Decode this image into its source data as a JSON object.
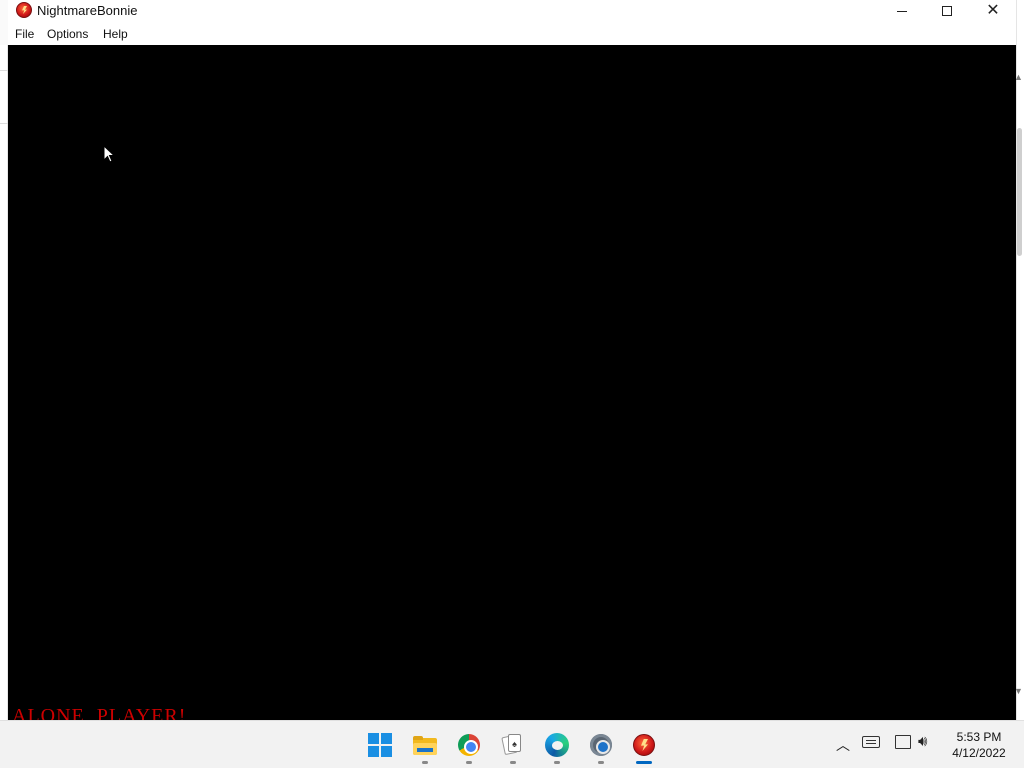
{
  "window": {
    "title": "NightmareBonnie",
    "menu": [
      "File",
      "Options",
      "Help"
    ]
  },
  "game": {
    "overlay_text": "ALONE, PLAYER!",
    "overlay_color": "#cc0000"
  },
  "taskbar": {
    "apps": [
      {
        "name": "start",
        "icon": "windows-start-icon"
      },
      {
        "name": "file-explorer",
        "icon": "folder-icon"
      },
      {
        "name": "chrome",
        "icon": "chrome-icon"
      },
      {
        "name": "solitaire",
        "icon": "cards-icon"
      },
      {
        "name": "edge",
        "icon": "edge-icon"
      },
      {
        "name": "settings",
        "icon": "gear-icon"
      },
      {
        "name": "nightmarebonnie",
        "icon": "game-icon",
        "active": true
      }
    ],
    "clock_time": "5:53 PM",
    "clock_date": "4/12/2022"
  }
}
